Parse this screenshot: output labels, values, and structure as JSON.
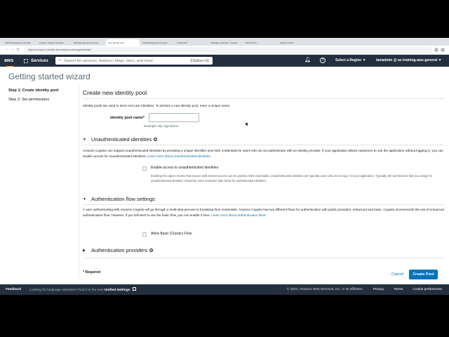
{
  "browser": {
    "tabs": [
      "AWS Management Console",
      "Amazon Cognito identities",
      "IAM Management Console",
      "New identity pool",
      "IAM Management Console",
      "AmazonS3",
      "Manage resources - Google",
      "AWS Cloud",
      "GitHub Copilot"
    ],
    "active_tab_index": 3,
    "url": "https://us-east-1.console.aws.amazon.com/cognito/create/"
  },
  "aws_nav": {
    "logo": "aws",
    "services_label": "Services",
    "search_placeholder": "Search for services, features, blogs, docs, and more",
    "search_shortcut": "[Option+S]",
    "region_label": "Select a Region ▼",
    "account_label": "iamadmin @ ac-training-aws-general ▼",
    "icons": [
      "bell-icon",
      "help-icon"
    ]
  },
  "wizard": {
    "title": "Getting started wizard",
    "steps": [
      "Step 1: Create identity pool",
      "Step 2: Set permissions"
    ]
  },
  "form": {
    "heading": "Create new identity pool",
    "description": "Identity pools are used to store end user identities. To declare a new identity pool, enter a unique name.",
    "pool_name_label": "Identity pool name*",
    "pool_name_value": "",
    "pool_name_example": "Example: My App Name"
  },
  "unauth": {
    "title": "Unauthenticated identities",
    "description": "Amazon Cognito can support unauthenticated identities by providing a unique identifier and AWS credentials for users who do not authenticate with an identity provider. If your application allows customers to use the application without logging in, you can enable access for unauthenticated identities.",
    "learn_more": "Learn more about unauthenticated identities.",
    "checkbox_label": "Enable access to unauthenticated identities",
    "checkbox_help": "Enabling this option means that anyone with internet access can be granted AWS credentials. Unauthenticated identities are typically users who do not log in to your application. Typically, the permissions that you assign for unauthenticated identities should be more restrictive than those for authenticated identities.",
    "checked": false
  },
  "authflow": {
    "title": "Authentication flow settings",
    "description": "A user authenticating with Amazon Cognito will go through a multi-step process to bootstrap their credentials. Amazon Cognito has two different flows for authentication with public providers: enhanced and basic. Cognito recommends the use of enhanced authentication flow. However, if you still wish to use the basic flow, you can enable it here.",
    "learn_more": "Learn more about authentication flows.",
    "checkbox_label": "Allow Basic (Classic) Flow",
    "checked": false
  },
  "providers": {
    "title": "Authentication providers"
  },
  "actions": {
    "required_note": "* Required",
    "cancel_label": "Cancel",
    "create_label": "Create Pool"
  },
  "footer": {
    "feedback": "Feedback",
    "language_text": "Looking for language selection? Find it in the new",
    "unified_settings": "Unified Settings",
    "copyright": "© 2022, Amazon Web Services, Inc. or its affiliates.",
    "privacy": "Privacy",
    "terms": "Terms",
    "cookies": "Cookie preferences"
  },
  "colors": {
    "aws_nav_bg": "#232f3e",
    "aws_orange": "#ff9900",
    "primary_blue": "#0073bb"
  }
}
